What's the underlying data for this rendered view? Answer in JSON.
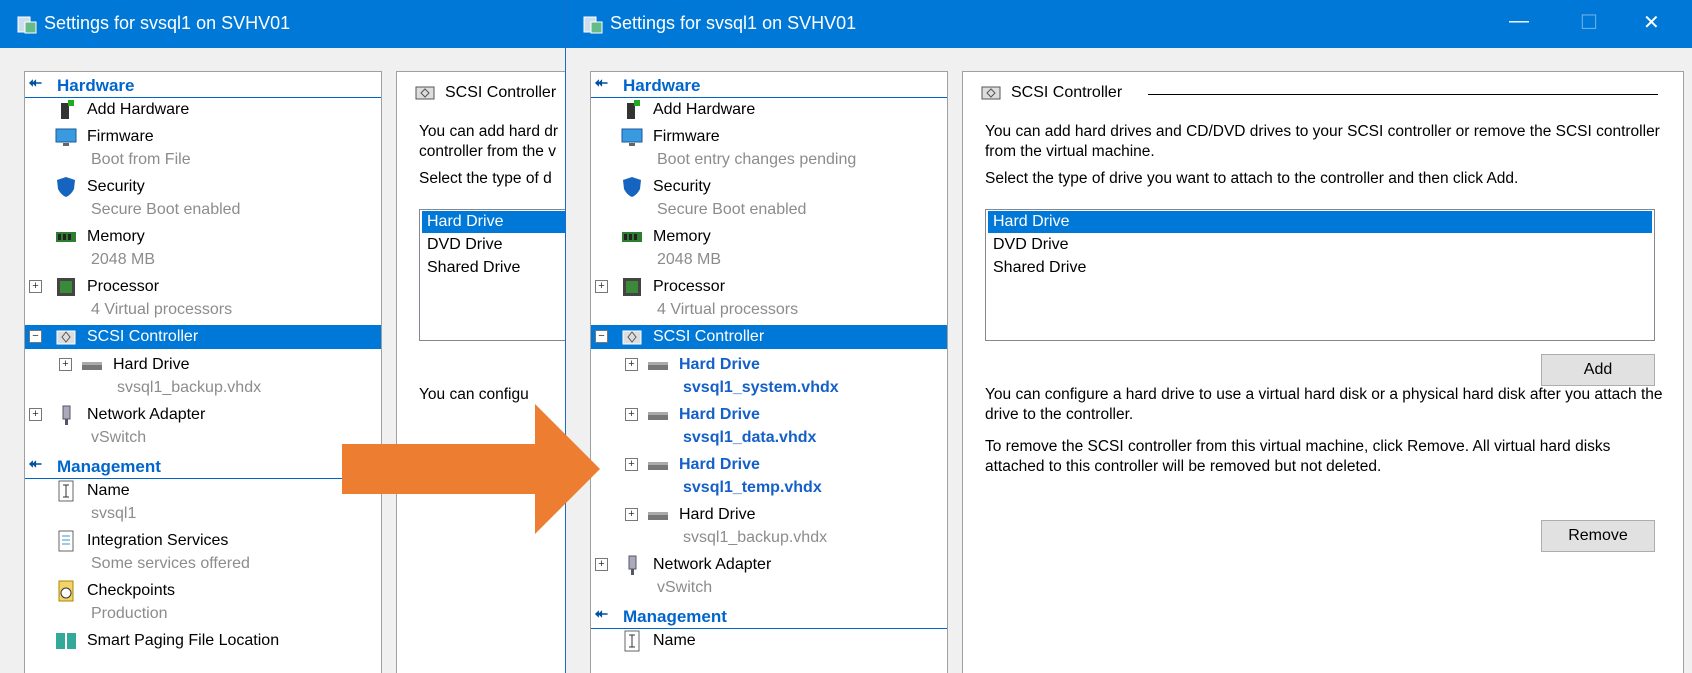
{
  "title": "Settings for svsql1 on SVHV01",
  "hardware_label": "Hardware",
  "management_label": "Management",
  "back": {
    "items": [
      {
        "name": "Add Hardware"
      },
      {
        "name": "Firmware",
        "sub": "Boot from File"
      },
      {
        "name": "Security",
        "sub": "Secure Boot enabled"
      },
      {
        "name": "Memory",
        "sub": "2048 MB"
      },
      {
        "name": "Processor",
        "sub": "4 Virtual processors"
      },
      {
        "name": "SCSI Controller"
      },
      {
        "name": "Hard Drive",
        "sub": "svsql1_backup.vhdx"
      },
      {
        "name": "Network Adapter",
        "sub": "vSwitch"
      }
    ],
    "management": [
      {
        "name": "Name",
        "sub": "svsql1"
      },
      {
        "name": "Integration Services",
        "sub": "Some services offered"
      },
      {
        "name": "Checkpoints",
        "sub": "Production"
      },
      {
        "name": "Smart Paging File Location"
      }
    ],
    "detail_title": "SCSI Controller",
    "p1a": "You can add hard dr",
    "p1b": "controller from the v",
    "p2": "Select the type of d",
    "p3": "You can configu"
  },
  "front": {
    "items": [
      {
        "name": "Add Hardware"
      },
      {
        "name": "Firmware",
        "sub": "Boot entry changes pending"
      },
      {
        "name": "Security",
        "sub": "Secure Boot enabled"
      },
      {
        "name": "Memory",
        "sub": "2048 MB"
      },
      {
        "name": "Processor",
        "sub": "4 Virtual processors"
      },
      {
        "name": "SCSI Controller"
      },
      {
        "name": "Hard Drive",
        "sub": "svsql1_system.vhdx"
      },
      {
        "name": "Hard Drive",
        "sub": "svsql1_data.vhdx"
      },
      {
        "name": "Hard Drive",
        "sub": "svsql1_temp.vhdx"
      },
      {
        "name": "Hard Drive",
        "sub": "svsql1_backup.vhdx"
      },
      {
        "name": "Network Adapter",
        "sub": "vSwitch"
      }
    ],
    "management": [
      {
        "name": "Name"
      }
    ],
    "detail_title": "SCSI Controller",
    "p1": "You can add hard drives and CD/DVD drives to your SCSI controller or remove the SCSI controller from the virtual machine.",
    "p2": "Select the type of drive you want to attach to the controller and then click Add.",
    "drive_types": [
      "Hard Drive",
      "DVD Drive",
      "Shared Drive"
    ],
    "add_label": "Add",
    "p3": "You can configure a hard drive to use a virtual hard disk or a physical hard disk after you attach the drive to the controller.",
    "p4": "To remove the SCSI controller from this virtual machine, click Remove. All virtual hard disks attached to this controller will be removed but not deleted.",
    "remove_label": "Remove"
  },
  "colors": {
    "accent": "#0078d7",
    "arrow": "#ed7d31",
    "link": "#1560c8"
  }
}
